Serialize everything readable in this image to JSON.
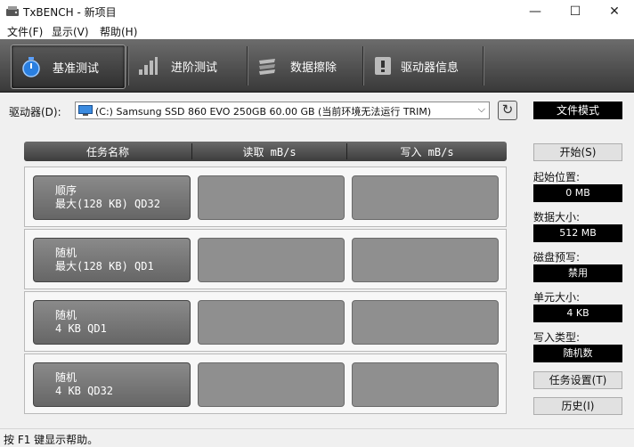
{
  "window": {
    "title": "TxBENCH - 新项目",
    "app_icon": "drive-icon",
    "controls": {
      "minimize": "—",
      "maximize": "☐",
      "close": "✕"
    }
  },
  "menu": {
    "items": [
      "文件(F)",
      "显示(V)",
      "帮助(H)"
    ]
  },
  "toolbar": {
    "tabs": [
      {
        "label": "基准测试",
        "icon": "stopwatch-icon",
        "active": true
      },
      {
        "label": "进阶测试",
        "icon": "bar-chart-icon",
        "active": false
      },
      {
        "label": "数据擦除",
        "icon": "eraser-icon",
        "active": false
      },
      {
        "label": "驱动器信息",
        "icon": "drive-info-icon",
        "active": false
      }
    ]
  },
  "drive": {
    "label": "驱动器(D):",
    "selected": "(C:) Samsung SSD 860 EVO 250GB  60.00 GB (当前环境无法运行 TRIM)",
    "mode": "文件模式"
  },
  "benchmark": {
    "headers": [
      "任务名称",
      "读取 mB/s",
      "写入 mB/s"
    ],
    "rows": [
      {
        "line1": "顺序",
        "line2": "最大(128 KB) QD32",
        "read": "",
        "write": ""
      },
      {
        "line1": "随机",
        "line2": "最大(128 KB) QD1",
        "read": "",
        "write": ""
      },
      {
        "line1": "随机",
        "line2": "4 KB QD1",
        "read": "",
        "write": ""
      },
      {
        "line1": "随机",
        "line2": "4 KB QD32",
        "read": "",
        "write": ""
      }
    ]
  },
  "panel": {
    "start_button": "开始(S)",
    "start_position_label": "起始位置:",
    "start_position_value": "0 MB",
    "data_size_label": "数据大小:",
    "data_size_value": "512 MB",
    "precondition_label": "磁盘预写:",
    "precondition_value": "禁用",
    "unit_size_label": "单元大小:",
    "unit_size_value": "4 KB",
    "write_type_label": "写入类型:",
    "write_type_value": "随机数",
    "task_settings_button": "任务设置(T)",
    "history_button": "历史(I)"
  },
  "status": {
    "text": "按 F1 键显示帮助。"
  },
  "colors": {
    "toolbar": "#4a4a4a",
    "value_box": "#000000",
    "result_box": "#8f8f8f"
  }
}
